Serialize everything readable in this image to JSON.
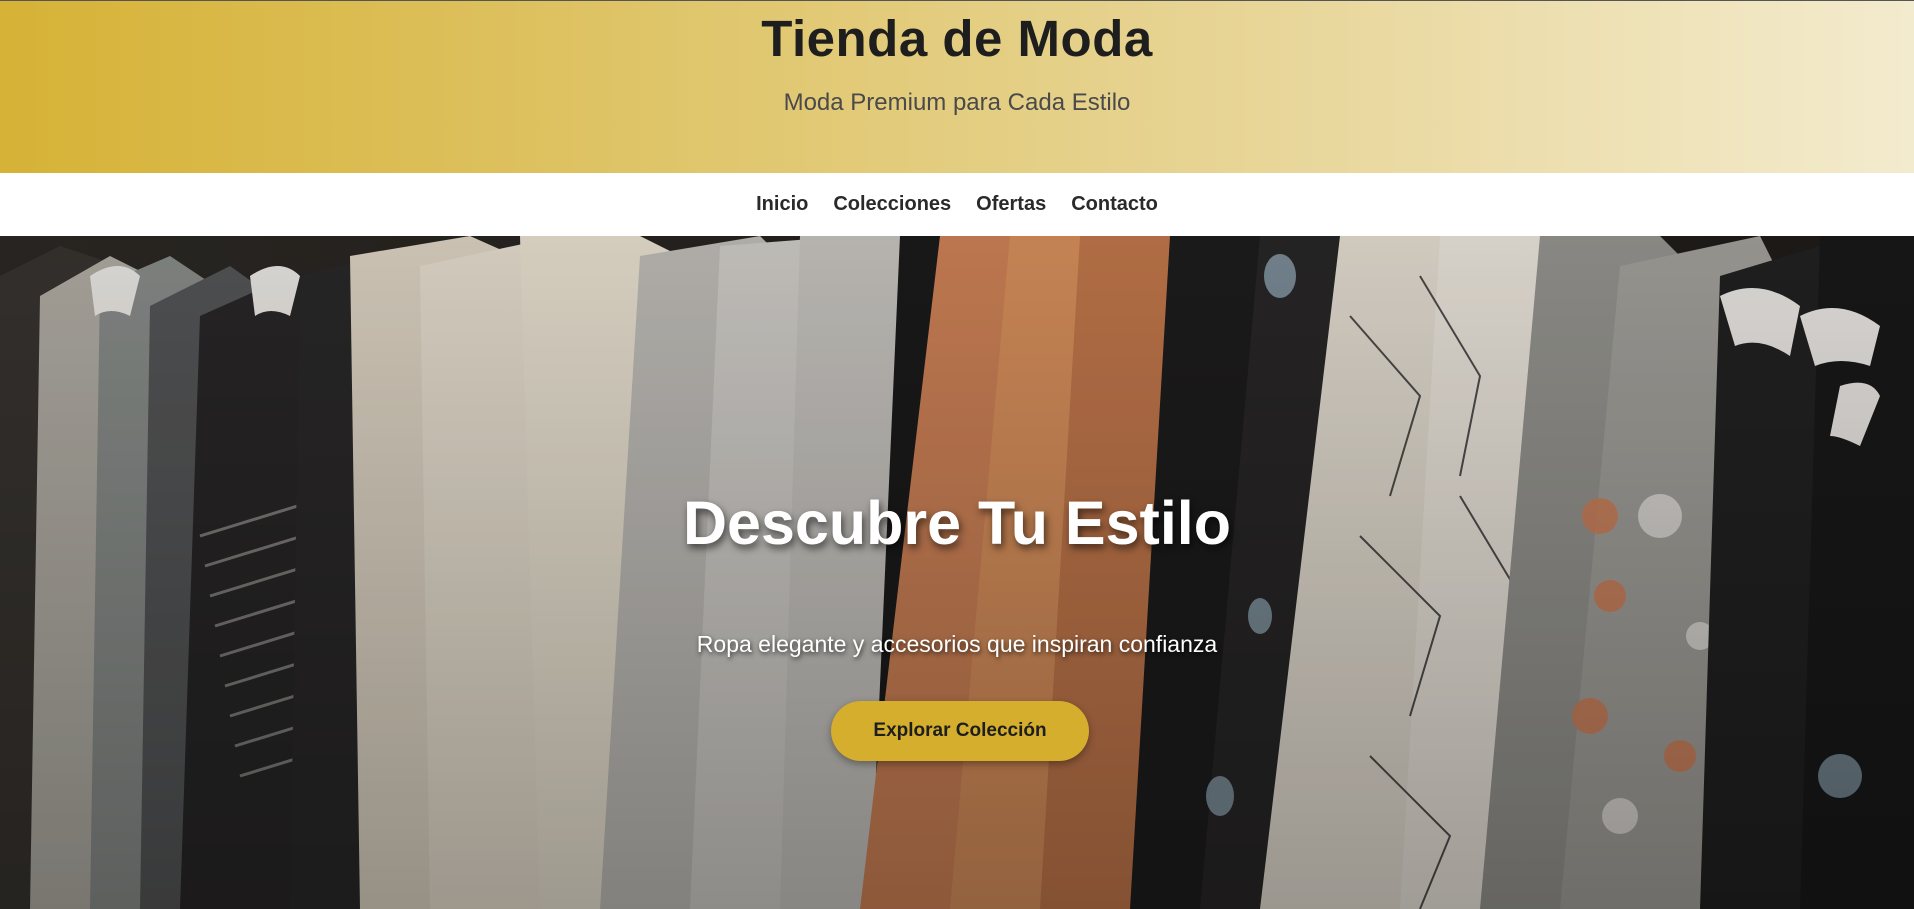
{
  "header": {
    "title": "Tienda de Moda",
    "subtitle": "Moda Premium para Cada Estilo"
  },
  "nav": {
    "items": [
      {
        "label": "Inicio"
      },
      {
        "label": "Colecciones"
      },
      {
        "label": "Ofertas"
      },
      {
        "label": "Contacto"
      }
    ]
  },
  "hero": {
    "title": "Descubre Tu Estilo",
    "text": "Ropa elegante y accesorios que inspiran confianza",
    "cta_label": "Explorar Colección",
    "image_description_icon": "clothing-rack-photo"
  },
  "colors": {
    "accent": "#d4ae2c",
    "header_gradient_start": "#d6b236",
    "header_gradient_end": "#f3ebce",
    "nav_background": "#ffffff",
    "title_text": "#1e1e1e"
  }
}
